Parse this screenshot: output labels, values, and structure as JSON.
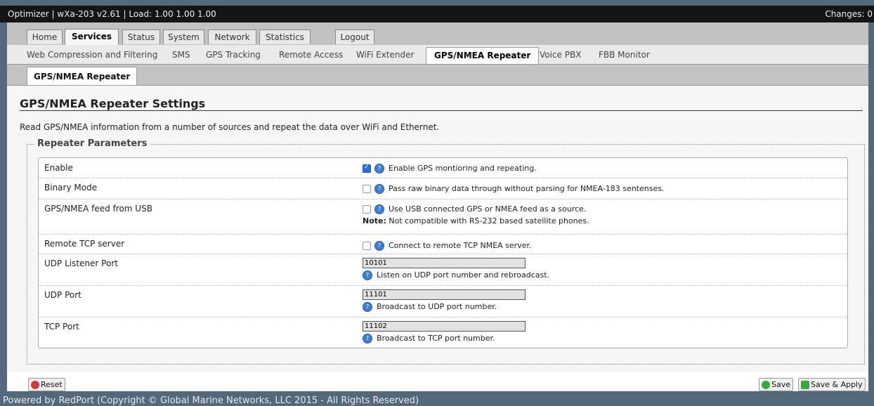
{
  "window": {
    "title": "Optimizer | wXa-203 v2.61 | Load: 1.00 1.00 1.00",
    "changes": "Changes: 0"
  },
  "main_tabs": [
    {
      "label": "Home"
    },
    {
      "label": "Services"
    },
    {
      "label": "Status"
    },
    {
      "label": "System"
    },
    {
      "label": "Network"
    },
    {
      "label": "Statistics"
    },
    {
      "label": "Logout"
    }
  ],
  "sub_tabs": [
    {
      "label": "Web Compression and Filtering"
    },
    {
      "label": "SMS"
    },
    {
      "label": "GPS Tracking"
    },
    {
      "label": "Remote Access"
    },
    {
      "label": "WiFi Extender"
    },
    {
      "label": "GPS/NMEA Repeater"
    },
    {
      "label": "Voice PBX"
    },
    {
      "label": "FBB Monitor"
    }
  ],
  "third_tab": "GPS/NMEA Repeater",
  "page": {
    "title": "GPS/NMEA Repeater Settings",
    "description": "Read GPS/NMEA information from a number of sources and repeat the data over WiFi and Ethernet.",
    "legend": "Repeater Parameters"
  },
  "rows": [
    {
      "label": "Enable",
      "checked": true,
      "desc": "Enable GPS montioring and repeating."
    },
    {
      "label": "Binary Mode",
      "checked": false,
      "desc": "Pass raw binary data through without parsing for NMEA-183 sentenses."
    },
    {
      "label": "GPS/NMEA feed from USB",
      "checked": false,
      "desc": "Use USB connected GPS or NMEA feed as a source.",
      "note_label": "Note:",
      "note": "Not compatible with RS-232 based satellite phones."
    },
    {
      "label": "Remote TCP server",
      "checked": false,
      "desc": "Connect to remote TCP NMEA server."
    },
    {
      "label": "UDP Listener Port",
      "value": "10101",
      "desc": "Listen on UDP port number and rebroadcast."
    },
    {
      "label": "UDP Port",
      "value": "11101",
      "desc": "Broadcast to UDP port number."
    },
    {
      "label": "TCP Port",
      "value": "11102",
      "desc": "Broadcast to TCP port number."
    }
  ],
  "buttons": {
    "reset": "Reset",
    "save": "Save",
    "save_apply": "Save & Apply"
  },
  "footer": "Powered by RedPort (Copyright © Global Marine Networks, LLC 2015 - All Rights Reserved)",
  "colors": {
    "accent": "#2d6fd8",
    "help": "#3e7fd1",
    "reset": "#d23a3a",
    "save": "#3aa83a"
  },
  "icons": {
    "help": "help-icon",
    "reset": "reset-icon",
    "save": "save-icon",
    "save_apply": "save-apply-icon"
  }
}
